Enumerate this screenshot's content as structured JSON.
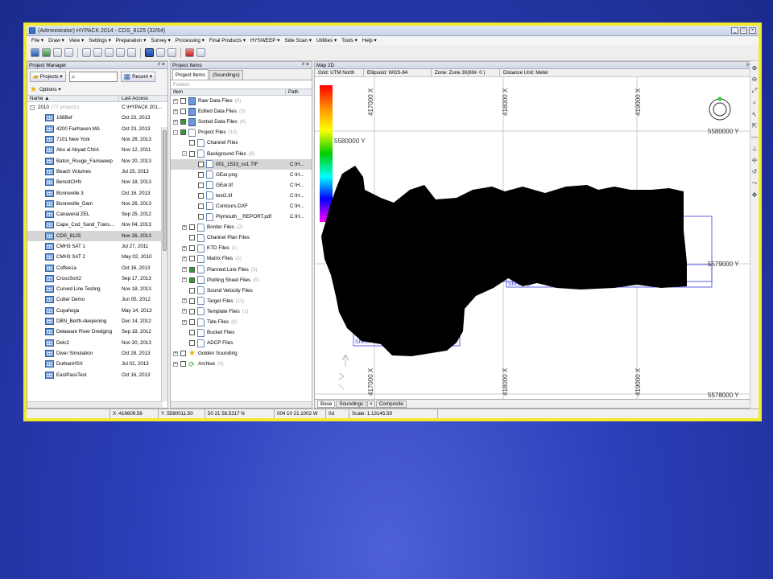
{
  "window": {
    "title": "(Administrator) HYPACK 2014 - CDS_8125 (32/64)"
  },
  "menu": [
    "File ▾",
    "Draw ▾",
    "View ▾",
    "Settings ▾",
    "Preparation ▾",
    "Survey ▾",
    "Processing ▾",
    "Final Products ▾",
    "HYSWEEP ▾",
    "Side Scan ▾",
    "Utilities ▾",
    "Tools ▾",
    "Help ▾"
  ],
  "toolbar_icons": [
    "save-icon",
    "globe-icon",
    "database-icon",
    "chart-icon",
    "pencil-icon",
    "tools-icon",
    "ruler-icon",
    "document-icon",
    "book-icon",
    "map-2d-icon",
    "curve-icon",
    "layer-icon",
    "delete-icon",
    "archive-icon"
  ],
  "project_manager": {
    "title": "Project Manager",
    "projects_button": "Projects ▾",
    "search_placeholder": "",
    "recent_button": "Recent ▾",
    "options_button": "Options ▾",
    "col_name": "Name ▲",
    "col_last": "Last Access",
    "group": {
      "name": "2010",
      "count": "(77 projects)",
      "path": "C:\\HYPACK 201..."
    },
    "rows": [
      {
        "name": "168Bef",
        "date": "Oct 23, 2013"
      },
      {
        "name": "4200 Fairhaven MA",
        "date": "Oct 23, 2013"
      },
      {
        "name": "7101 New York",
        "date": "Nov 26, 2013"
      },
      {
        "name": "Abu al Abyad CNIA",
        "date": "Nov 12, 2011"
      },
      {
        "name": "Baton_Rouge_Fansweep",
        "date": "Nov 20, 2013"
      },
      {
        "name": "Beach Volumes",
        "date": "Jul 25, 2013"
      },
      {
        "name": "BenoitCHN",
        "date": "Nov 18, 2013"
      },
      {
        "name": "Bonneville 3",
        "date": "Oct 16, 2013"
      },
      {
        "name": "Bonneville_Dam",
        "date": "Nov 26, 2013"
      },
      {
        "name": "Canaveral ZEL",
        "date": "Sep 25, 2012"
      },
      {
        "name": "Cape_Cod_Sand_Trans...",
        "date": "Nov 04, 2013"
      },
      {
        "name": "CDS_8125",
        "date": "Nov 26, 2013",
        "selected": true
      },
      {
        "name": "CMH3 SAT 1",
        "date": "Jul 27, 2011"
      },
      {
        "name": "CMH3 SAT 2",
        "date": "May 02, 2010"
      },
      {
        "name": "Coffee1a",
        "date": "Oct 16, 2013"
      },
      {
        "name": "CrossSort2",
        "date": "Sep 17, 2013"
      },
      {
        "name": "Curved Line Testing",
        "date": "Nov 18, 2013"
      },
      {
        "name": "Cutter Demo",
        "date": "Jun 05, 2012"
      },
      {
        "name": "Cuyahoga",
        "date": "May 14, 2013"
      },
      {
        "name": "DBN_Berth-deepening",
        "date": "Dec 14, 2012"
      },
      {
        "name": "Delaware River Dredging",
        "date": "Sep 18, 2012"
      },
      {
        "name": "Delc2",
        "date": "Nov 20, 2013"
      },
      {
        "name": "Diver Simulation",
        "date": "Oct 28, 2013"
      },
      {
        "name": "DurbanHSX",
        "date": "Jul 02, 2013"
      },
      {
        "name": "EastPassTest",
        "date": "Oct 16, 2013"
      }
    ]
  },
  "project_items": {
    "title": "Project Items",
    "tab_items": "Project Items",
    "tab_soundings": "(Soundings)",
    "folders_label": "Folders",
    "col_item": "Item",
    "col_path": "Path",
    "rows": [
      {
        "indent": 0,
        "exp": "+",
        "chk": "",
        "icon": "grid",
        "label": "Raw Data Files",
        "count": "(8)",
        "path": ""
      },
      {
        "indent": 0,
        "exp": "+",
        "chk": "",
        "icon": "grid",
        "label": "Edited Data Files",
        "count": "(3)",
        "path": ""
      },
      {
        "indent": 0,
        "exp": "+",
        "chk": "on",
        "icon": "grid",
        "label": "Sorted Data Files",
        "count": "(4)",
        "path": ""
      },
      {
        "indent": 0,
        "exp": "-",
        "chk": "on",
        "icon": "doc",
        "label": "Project Files",
        "count": "(14)",
        "path": ""
      },
      {
        "indent": 1,
        "exp": "",
        "chk": "",
        "icon": "doc",
        "label": "Channel Files",
        "count": "",
        "path": ""
      },
      {
        "indent": 1,
        "exp": "-",
        "chk": "",
        "icon": "doc",
        "label": "Background Files",
        "count": "(6)",
        "path": ""
      },
      {
        "indent": 2,
        "exp": "",
        "chk": "",
        "icon": "doc",
        "label": "001_1533_ss1.TIF",
        "count": "",
        "path": "C:\\H...",
        "selected": true
      },
      {
        "indent": 2,
        "exp": "",
        "chk": "",
        "icon": "doc",
        "label": "GEar.png",
        "count": "",
        "path": "C:\\H..."
      },
      {
        "indent": 2,
        "exp": "",
        "chk": "",
        "icon": "doc",
        "label": "GEar.tif",
        "count": "",
        "path": "C:\\H..."
      },
      {
        "indent": 2,
        "exp": "",
        "chk": "",
        "icon": "doc",
        "label": "test2.tif",
        "count": "",
        "path": "C:\\H..."
      },
      {
        "indent": 2,
        "exp": "",
        "chk": "",
        "icon": "doc",
        "label": "Contours.DXF",
        "count": "",
        "path": "C:\\H..."
      },
      {
        "indent": 2,
        "exp": "",
        "chk": "",
        "icon": "doc",
        "label": "Plymouth__REPORT.pdf",
        "count": "",
        "path": "C:\\H..."
      },
      {
        "indent": 1,
        "exp": "+",
        "chk": "",
        "icon": "doc",
        "label": "Border Files",
        "count": "(2)",
        "path": ""
      },
      {
        "indent": 1,
        "exp": "",
        "chk": "",
        "icon": "doc",
        "label": "Channel Plan Files",
        "count": "",
        "path": ""
      },
      {
        "indent": 1,
        "exp": "+",
        "chk": "",
        "icon": "doc",
        "label": "KTD Files",
        "count": "(1)",
        "path": ""
      },
      {
        "indent": 1,
        "exp": "+",
        "chk": "",
        "icon": "doc",
        "label": "Matrix Files",
        "count": "(3)",
        "path": ""
      },
      {
        "indent": 1,
        "exp": "+",
        "chk": "on",
        "icon": "doc",
        "label": "Planned Line Files",
        "count": "(3)",
        "path": ""
      },
      {
        "indent": 1,
        "exp": "+",
        "chk": "on",
        "icon": "doc",
        "label": "Plotting Sheet Files",
        "count": "(9)",
        "path": ""
      },
      {
        "indent": 1,
        "exp": "",
        "chk": "",
        "icon": "doc",
        "label": "Sound Velocity Files",
        "count": "",
        "path": ""
      },
      {
        "indent": 1,
        "exp": "+",
        "chk": "",
        "icon": "doc",
        "label": "Target Files",
        "count": "(11)",
        "path": ""
      },
      {
        "indent": 1,
        "exp": "+",
        "chk": "",
        "icon": "doc",
        "label": "Template Files",
        "count": "(1)",
        "path": ""
      },
      {
        "indent": 1,
        "exp": "+",
        "chk": "",
        "icon": "doc",
        "label": "Tide Files",
        "count": "(8)",
        "path": ""
      },
      {
        "indent": 1,
        "exp": "",
        "chk": "",
        "icon": "doc",
        "label": "Bucket Files",
        "count": "",
        "path": ""
      },
      {
        "indent": 1,
        "exp": "",
        "chk": "",
        "icon": "doc",
        "label": "ADCP Files",
        "count": "",
        "path": ""
      },
      {
        "indent": 0,
        "exp": "+",
        "chk": "",
        "icon": "star",
        "label": "Golden Sounding",
        "count": "",
        "path": ""
      },
      {
        "indent": 0,
        "exp": "+",
        "chk": "",
        "icon": "archive",
        "label": "Archive",
        "count": "(4)",
        "path": ""
      }
    ]
  },
  "map": {
    "title": "Map 2D",
    "grid": "Grid: UTM North",
    "ellipsoid": "Ellipsoid: WGS-84",
    "zone": "Zone: Zone 30(6W- 0 )",
    "units": "Distance Unit: Meter",
    "x_labels": [
      "417000 X",
      "418000 X",
      "419000 X"
    ],
    "y_labels": [
      "5580000 Y",
      "5579000 Y",
      "5578000 Y",
      "5580000 Y"
    ],
    "sheet_labels": [
      "Sheet3.pl",
      "Sheet"
    ],
    "tabs": [
      "Base",
      "Soundings",
      "Composite"
    ]
  },
  "status": {
    "x": "X :416609.56",
    "y": "Y :5580011.50",
    "lat": "50 21 58.5317 N",
    "lon": "004 10 21.1002 W",
    "heading": "0d",
    "scale": "Scale: 1:13145.59"
  },
  "colors": {
    "frame": "#f2ea2e",
    "background": "#2a3eb8"
  }
}
